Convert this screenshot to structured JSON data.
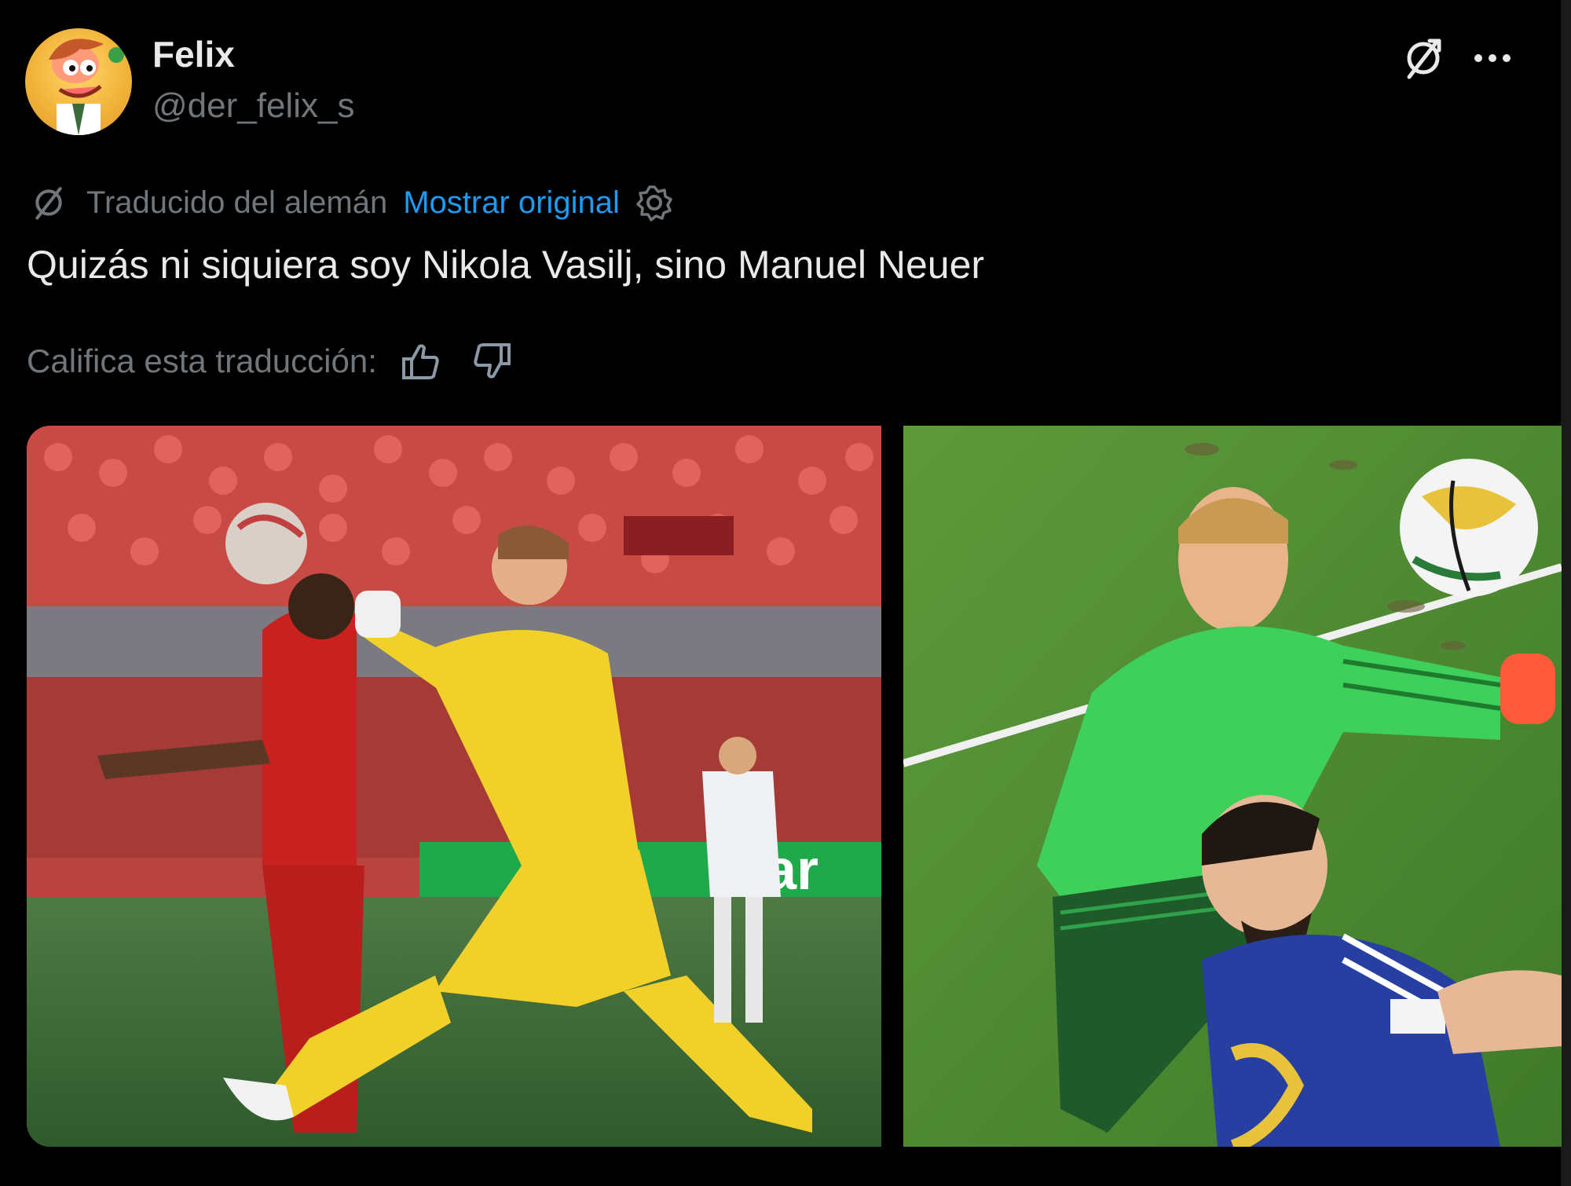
{
  "tweet": {
    "author": {
      "display_name": "Felix",
      "handle": "@der_felix_s"
    },
    "translation": {
      "label": "Traducido del alemán",
      "show_original": "Mostrar original"
    },
    "text": "Quizás ni siquiera soy Nikola Vasilj, sino Manuel Neuer",
    "rate": {
      "label": "Califica esta traducción:"
    },
    "icons": [
      "translate-icon",
      "more-icon",
      "gear-icon",
      "thumbs-up-icon",
      "thumbs-down-icon"
    ],
    "colors": {
      "background": "#000000",
      "primary_text": "#e7e9ea",
      "secondary_text": "#71767b",
      "link": "#1d9bf0"
    }
  }
}
